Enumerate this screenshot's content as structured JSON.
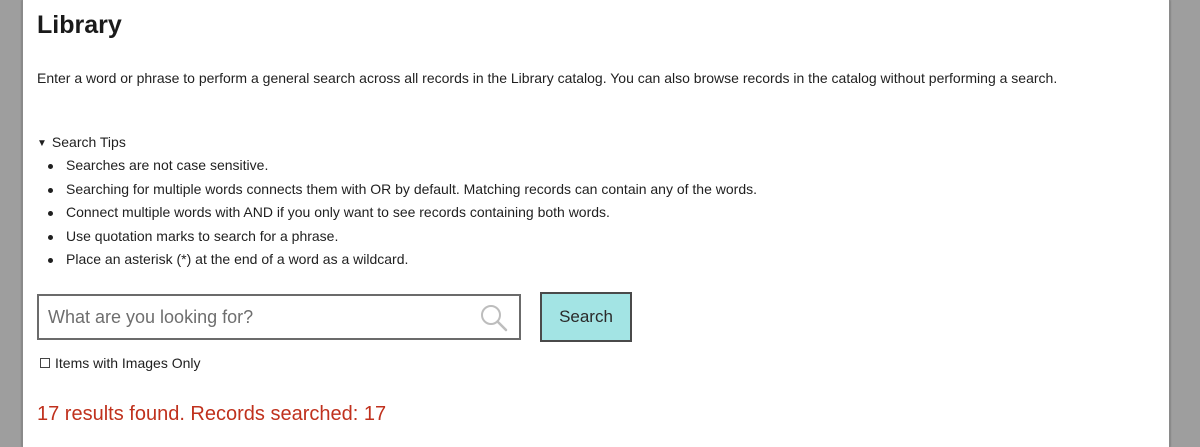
{
  "page": {
    "title": "Library",
    "intro": "Enter a word or phrase to perform a general search across all records in the Library catalog. You can also browse records in the catalog without performing a search."
  },
  "search_tips": {
    "toggle_label": "Search Tips",
    "expanded": true,
    "items": [
      "Searches are not case sensitive.",
      "Searching for multiple words connects them with OR by default. Matching records can contain any of the words.",
      "Connect multiple words with AND if you only want to see records containing both words.",
      "Use quotation marks to search for a phrase.",
      "Place an asterisk (*) at the end of a word as a wildcard."
    ]
  },
  "search": {
    "value": "",
    "placeholder": "What are you looking for?",
    "icon": "magnifier-icon",
    "button_label": "Search"
  },
  "filters": {
    "images_only_label": "Items with Images Only",
    "images_only_checked": false
  },
  "results": {
    "summary": "17 results found. Records searched: 17"
  },
  "colors": {
    "background": "#9e9e9e",
    "panel": "#ffffff",
    "search_button": "#a3e4e4",
    "results_text": "#c0311d"
  }
}
